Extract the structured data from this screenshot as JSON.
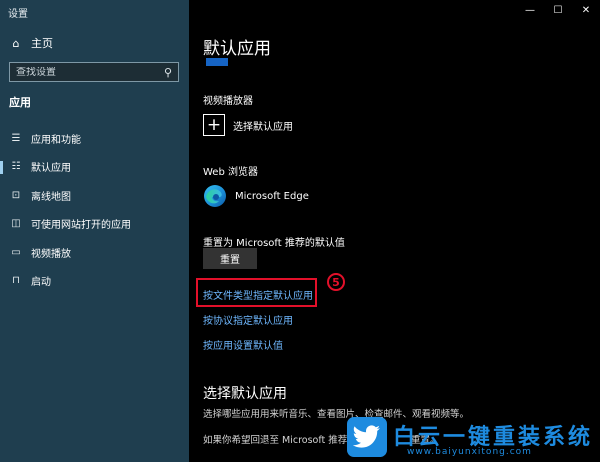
{
  "window": {
    "title": "设置",
    "minimize_glyph": "—",
    "maximize_glyph": "☐",
    "close_glyph": "✕"
  },
  "sidebar": {
    "home_label": "主页",
    "search_placeholder": "查找设置",
    "section_title": "应用",
    "items": [
      {
        "label": "应用和功能",
        "icon": "list-icon",
        "glyph": "☰"
      },
      {
        "label": "默认应用",
        "icon": "default-apps-icon",
        "glyph": "☷",
        "selected": true
      },
      {
        "label": "离线地图",
        "icon": "map-icon",
        "glyph": "⊡"
      },
      {
        "label": "可使用网站打开的应用",
        "icon": "website-icon",
        "glyph": "◫"
      },
      {
        "label": "视频播放",
        "icon": "video-icon",
        "glyph": "▭"
      },
      {
        "label": "启动",
        "icon": "startup-icon",
        "glyph": "⊓"
      }
    ]
  },
  "main": {
    "page_title": "默认应用",
    "video_player_label": "视频播放器",
    "choose_default_label": "选择默认应用",
    "web_browser_label": "Web 浏览器",
    "browser_name": "Microsoft Edge",
    "reset_label": "重置为 Microsoft 推荐的默认值",
    "reset_button": "重置",
    "link_by_file_type": "按文件类型指定默认应用",
    "link_by_protocol": "按协议指定默认应用",
    "link_by_app": "按应用设置默认值",
    "step_badge": "5",
    "choose_section_title": "选择默认应用",
    "choose_section_desc": "选择哪些应用用来听音乐、查看图片、检查邮件、观看视频等。",
    "partial_text_left": "如果你希望回退至 Microsoft 推荐",
    "partial_text_right": "重置。"
  },
  "watermark": {
    "text": "白云一键重装系统",
    "url": "www.baiyunxitong.com"
  },
  "colors": {
    "sidebar_bg": "#1f3e4f",
    "link": "#6fb8ff",
    "highlight": "#e3102a",
    "accent": "#9fd0ef"
  }
}
